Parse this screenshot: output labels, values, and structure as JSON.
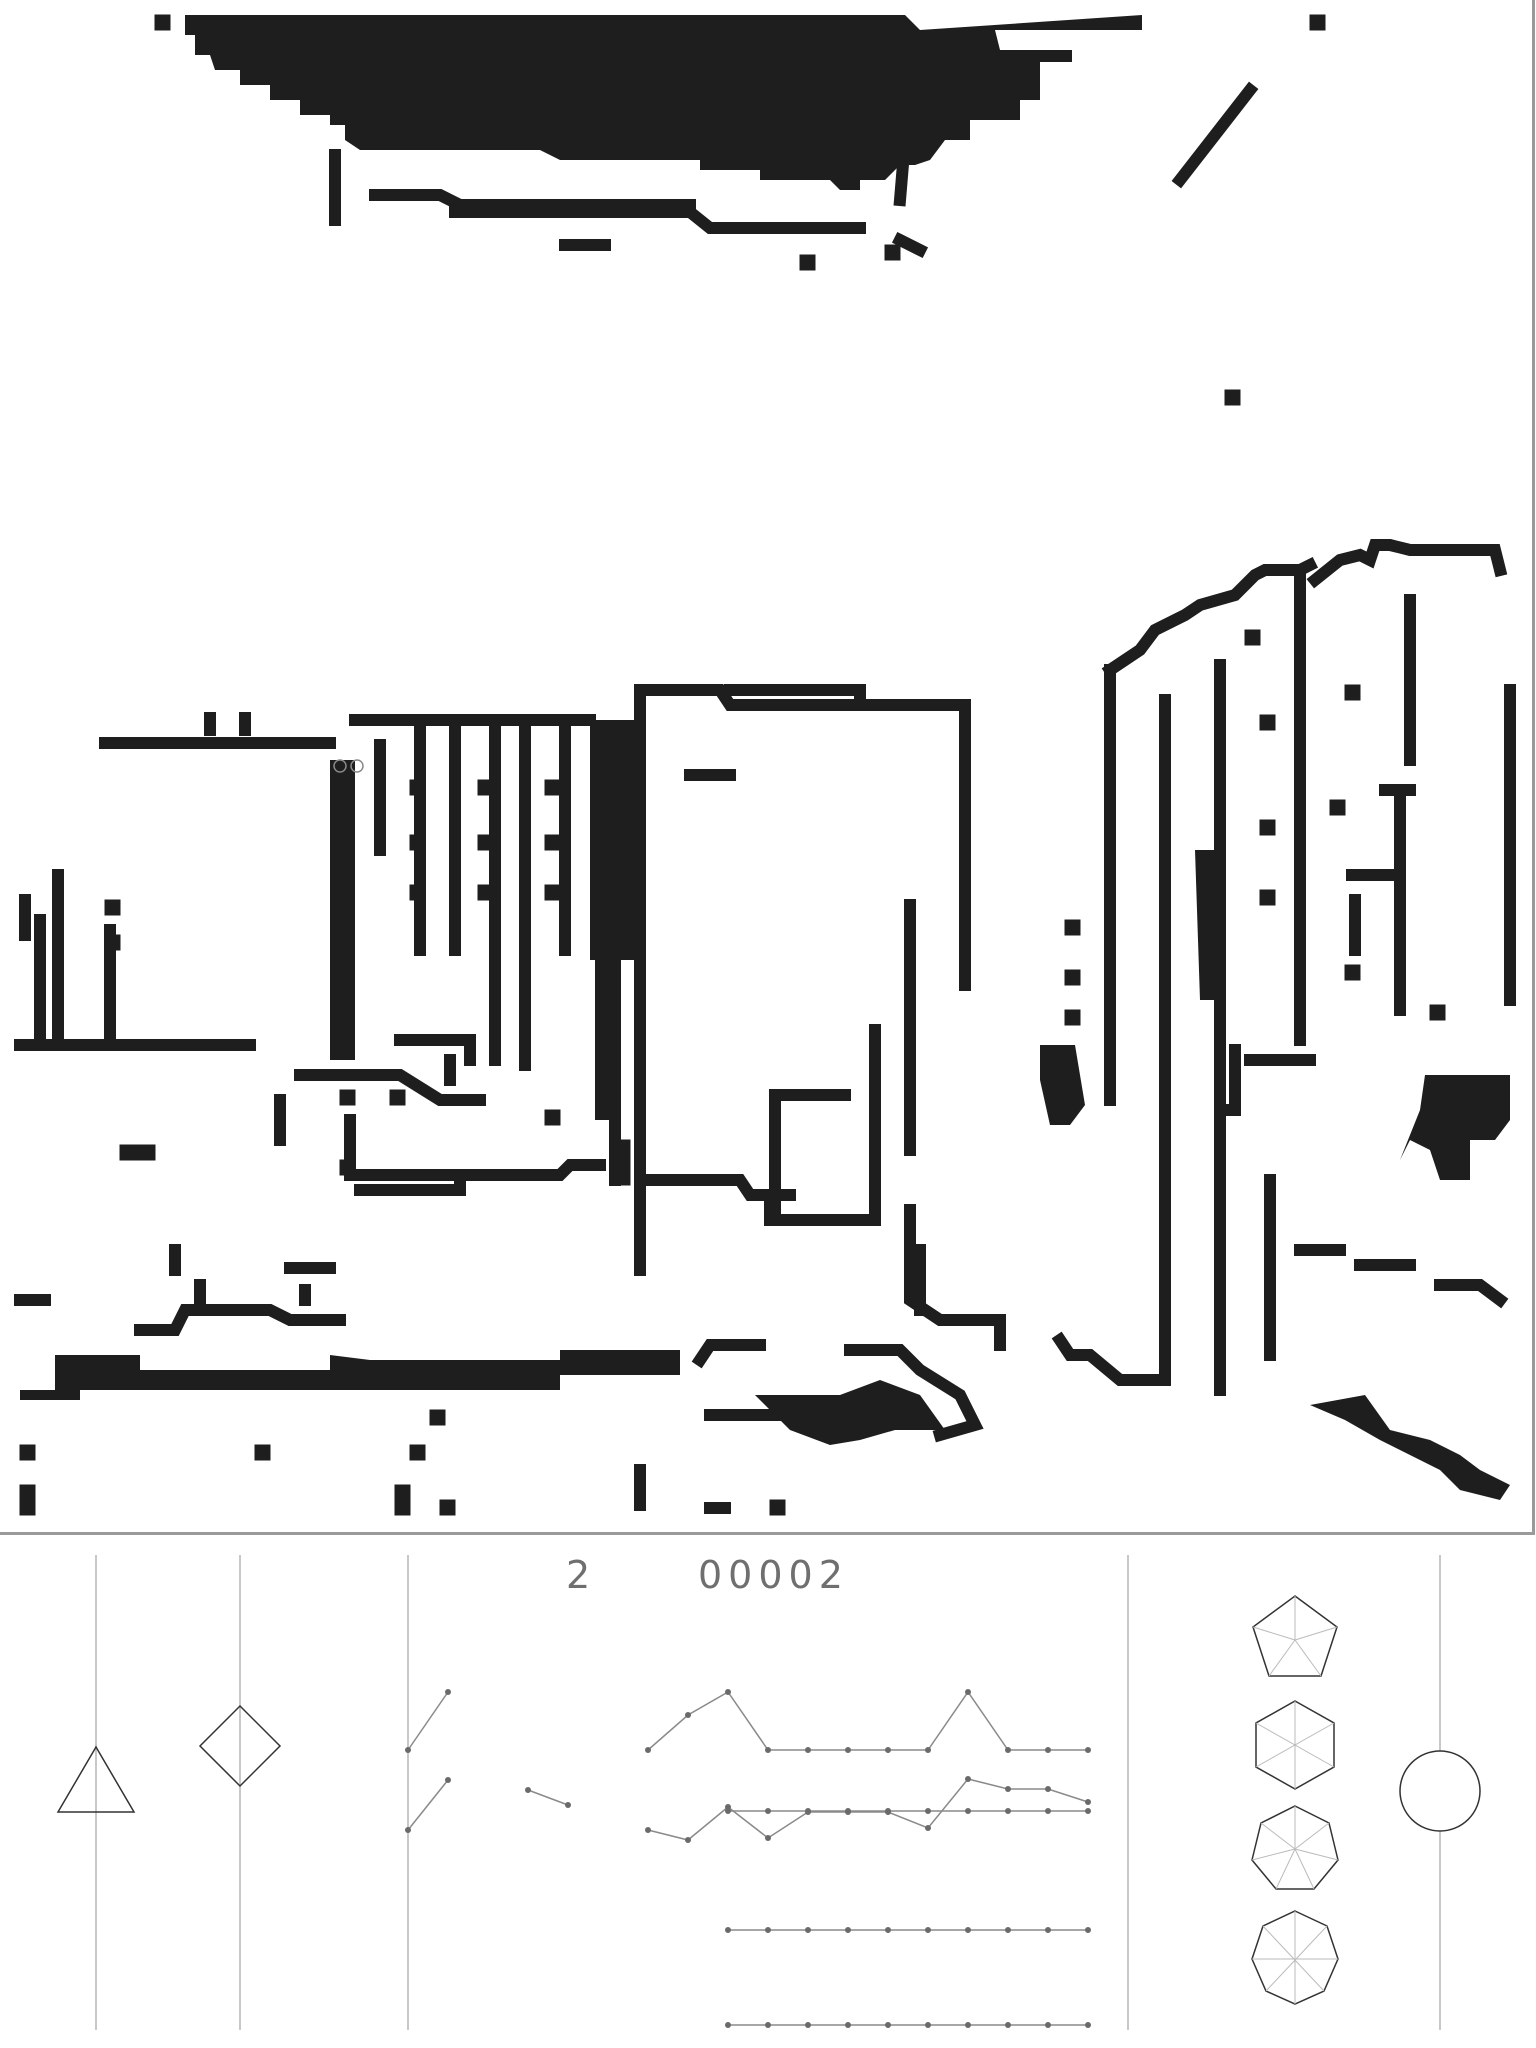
{
  "readouts": {
    "left": "2",
    "right": "00002"
  },
  "scene": {
    "style": "1-bit edge-detected street scene",
    "ink_color": "#1e1e1e"
  },
  "icons": [
    "triangle-icon",
    "diamond-icon",
    "pentagon-icon",
    "hexagon-icon",
    "heptagon-icon",
    "octagon-icon",
    "circle-icon"
  ]
}
